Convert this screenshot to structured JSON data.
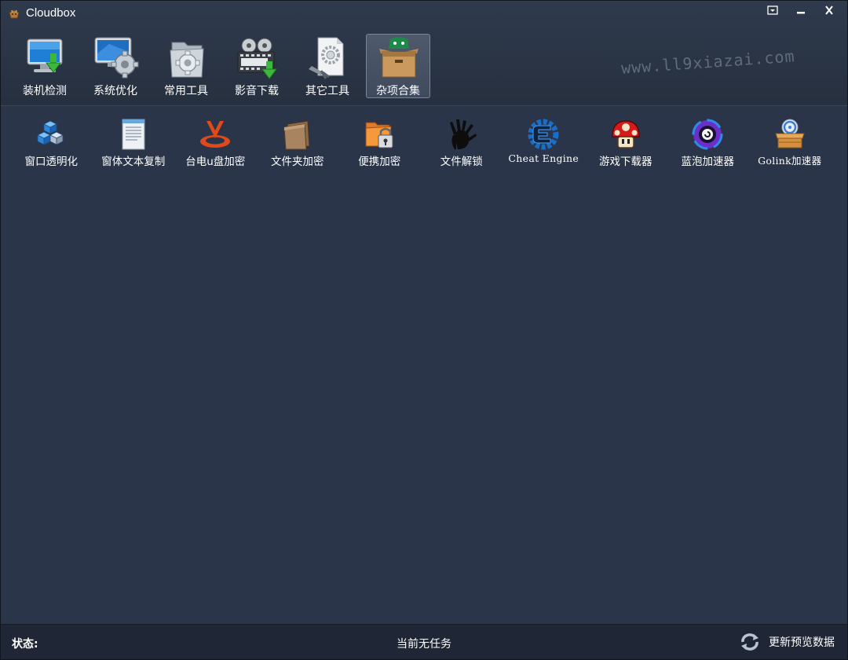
{
  "window": {
    "title": "Cloudbox",
    "controls": {
      "restore": "restore",
      "minimize": "minimize",
      "close": "close"
    }
  },
  "watermark": "www.ll9xiazai.com",
  "toolbar": {
    "items": [
      {
        "label": "装机检测",
        "icon": "monitor-download-icon"
      },
      {
        "label": "系统优化",
        "icon": "monitor-gear-icon"
      },
      {
        "label": "常用工具",
        "icon": "folder-gear-icon"
      },
      {
        "label": "影音下载",
        "icon": "film-download-icon"
      },
      {
        "label": "其它工具",
        "icon": "paper-gear-icon"
      },
      {
        "label": "杂项合集",
        "icon": "box-icon",
        "selected": true
      }
    ]
  },
  "apps": {
    "items": [
      {
        "label": "窗口透明化",
        "icon": "blue-cubes-icon"
      },
      {
        "label": "窗体文本复制",
        "icon": "document-icon"
      },
      {
        "label": "台电u盘加密",
        "icon": "teclast-logo-icon"
      },
      {
        "label": "文件夹加密",
        "icon": "brown-folder-icon"
      },
      {
        "label": "便携加密",
        "icon": "folder-lock-icon"
      },
      {
        "label": "文件解锁",
        "icon": "handprint-icon"
      },
      {
        "label": "Cheat Engine",
        "icon": "cheat-engine-icon"
      },
      {
        "label": "游戏下载器",
        "icon": "mushroom-icon"
      },
      {
        "label": "蓝泡加速器",
        "icon": "purple-orb-icon"
      },
      {
        "label": "Golink加速器",
        "icon": "box-disc-icon"
      }
    ]
  },
  "statusbar": {
    "label": "状态:",
    "message": "当前无任务",
    "refresh_label": "更新预览数据",
    "refresh_icon": "refresh-icon"
  },
  "colors": {
    "background": "#2b3549",
    "toolbar": "#26303f",
    "statusbar": "#1f2635",
    "text": "#ffffff"
  }
}
